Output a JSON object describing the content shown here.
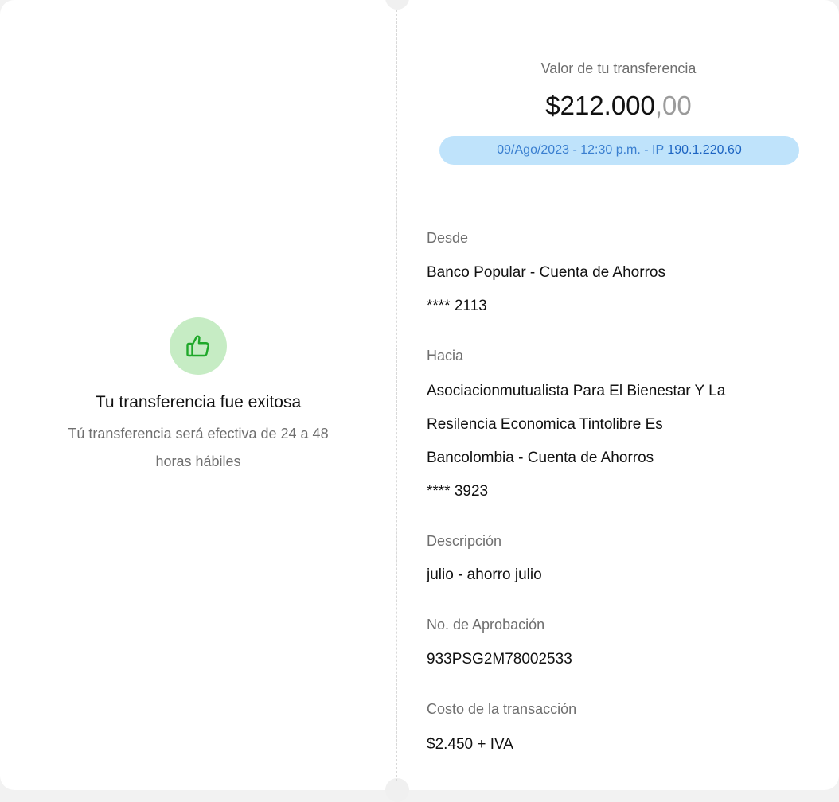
{
  "receipt": {
    "status_icon": "thumbs-up-icon",
    "success_title": "Tu transferencia fue exitosa",
    "success_subtitle_line1": "Tú transferencia será efectiva de 24 a 48",
    "success_subtitle_line2": "horas hábiles",
    "amount_label": "Valor de tu transferencia",
    "amount_integer": "$212.000",
    "amount_cents": ",00",
    "meta_datetime": "09/Ago/2023 - 12:30 p.m. - IP ",
    "meta_ip": "190.1.220.60",
    "colors": {
      "success_badge": "#c6ecc4",
      "success_icon": "#1fa82a",
      "meta_pill_bg": "#bfe3fb",
      "meta_pill_text": "#3a7fd0"
    }
  },
  "details": {
    "from": {
      "label": "Desde",
      "bank": "Banco Popular - Cuenta de Ahorros",
      "account": "**** 2113"
    },
    "to": {
      "label": "Hacia",
      "name_line1": "Asociacionmutualista Para El Bienestar Y La",
      "name_line2": "Resilencia Economica Tintolibre Es",
      "bank": "Bancolombia - Cuenta de Ahorros",
      "account": "**** 3923"
    },
    "description": {
      "label": "Descripción",
      "value": "julio - ahorro julio"
    },
    "approval": {
      "label": "No. de Aprobación",
      "value": "933PSG2M78002533"
    },
    "cost": {
      "label": "Costo de la transacción",
      "value": "$2.450 + IVA"
    }
  }
}
